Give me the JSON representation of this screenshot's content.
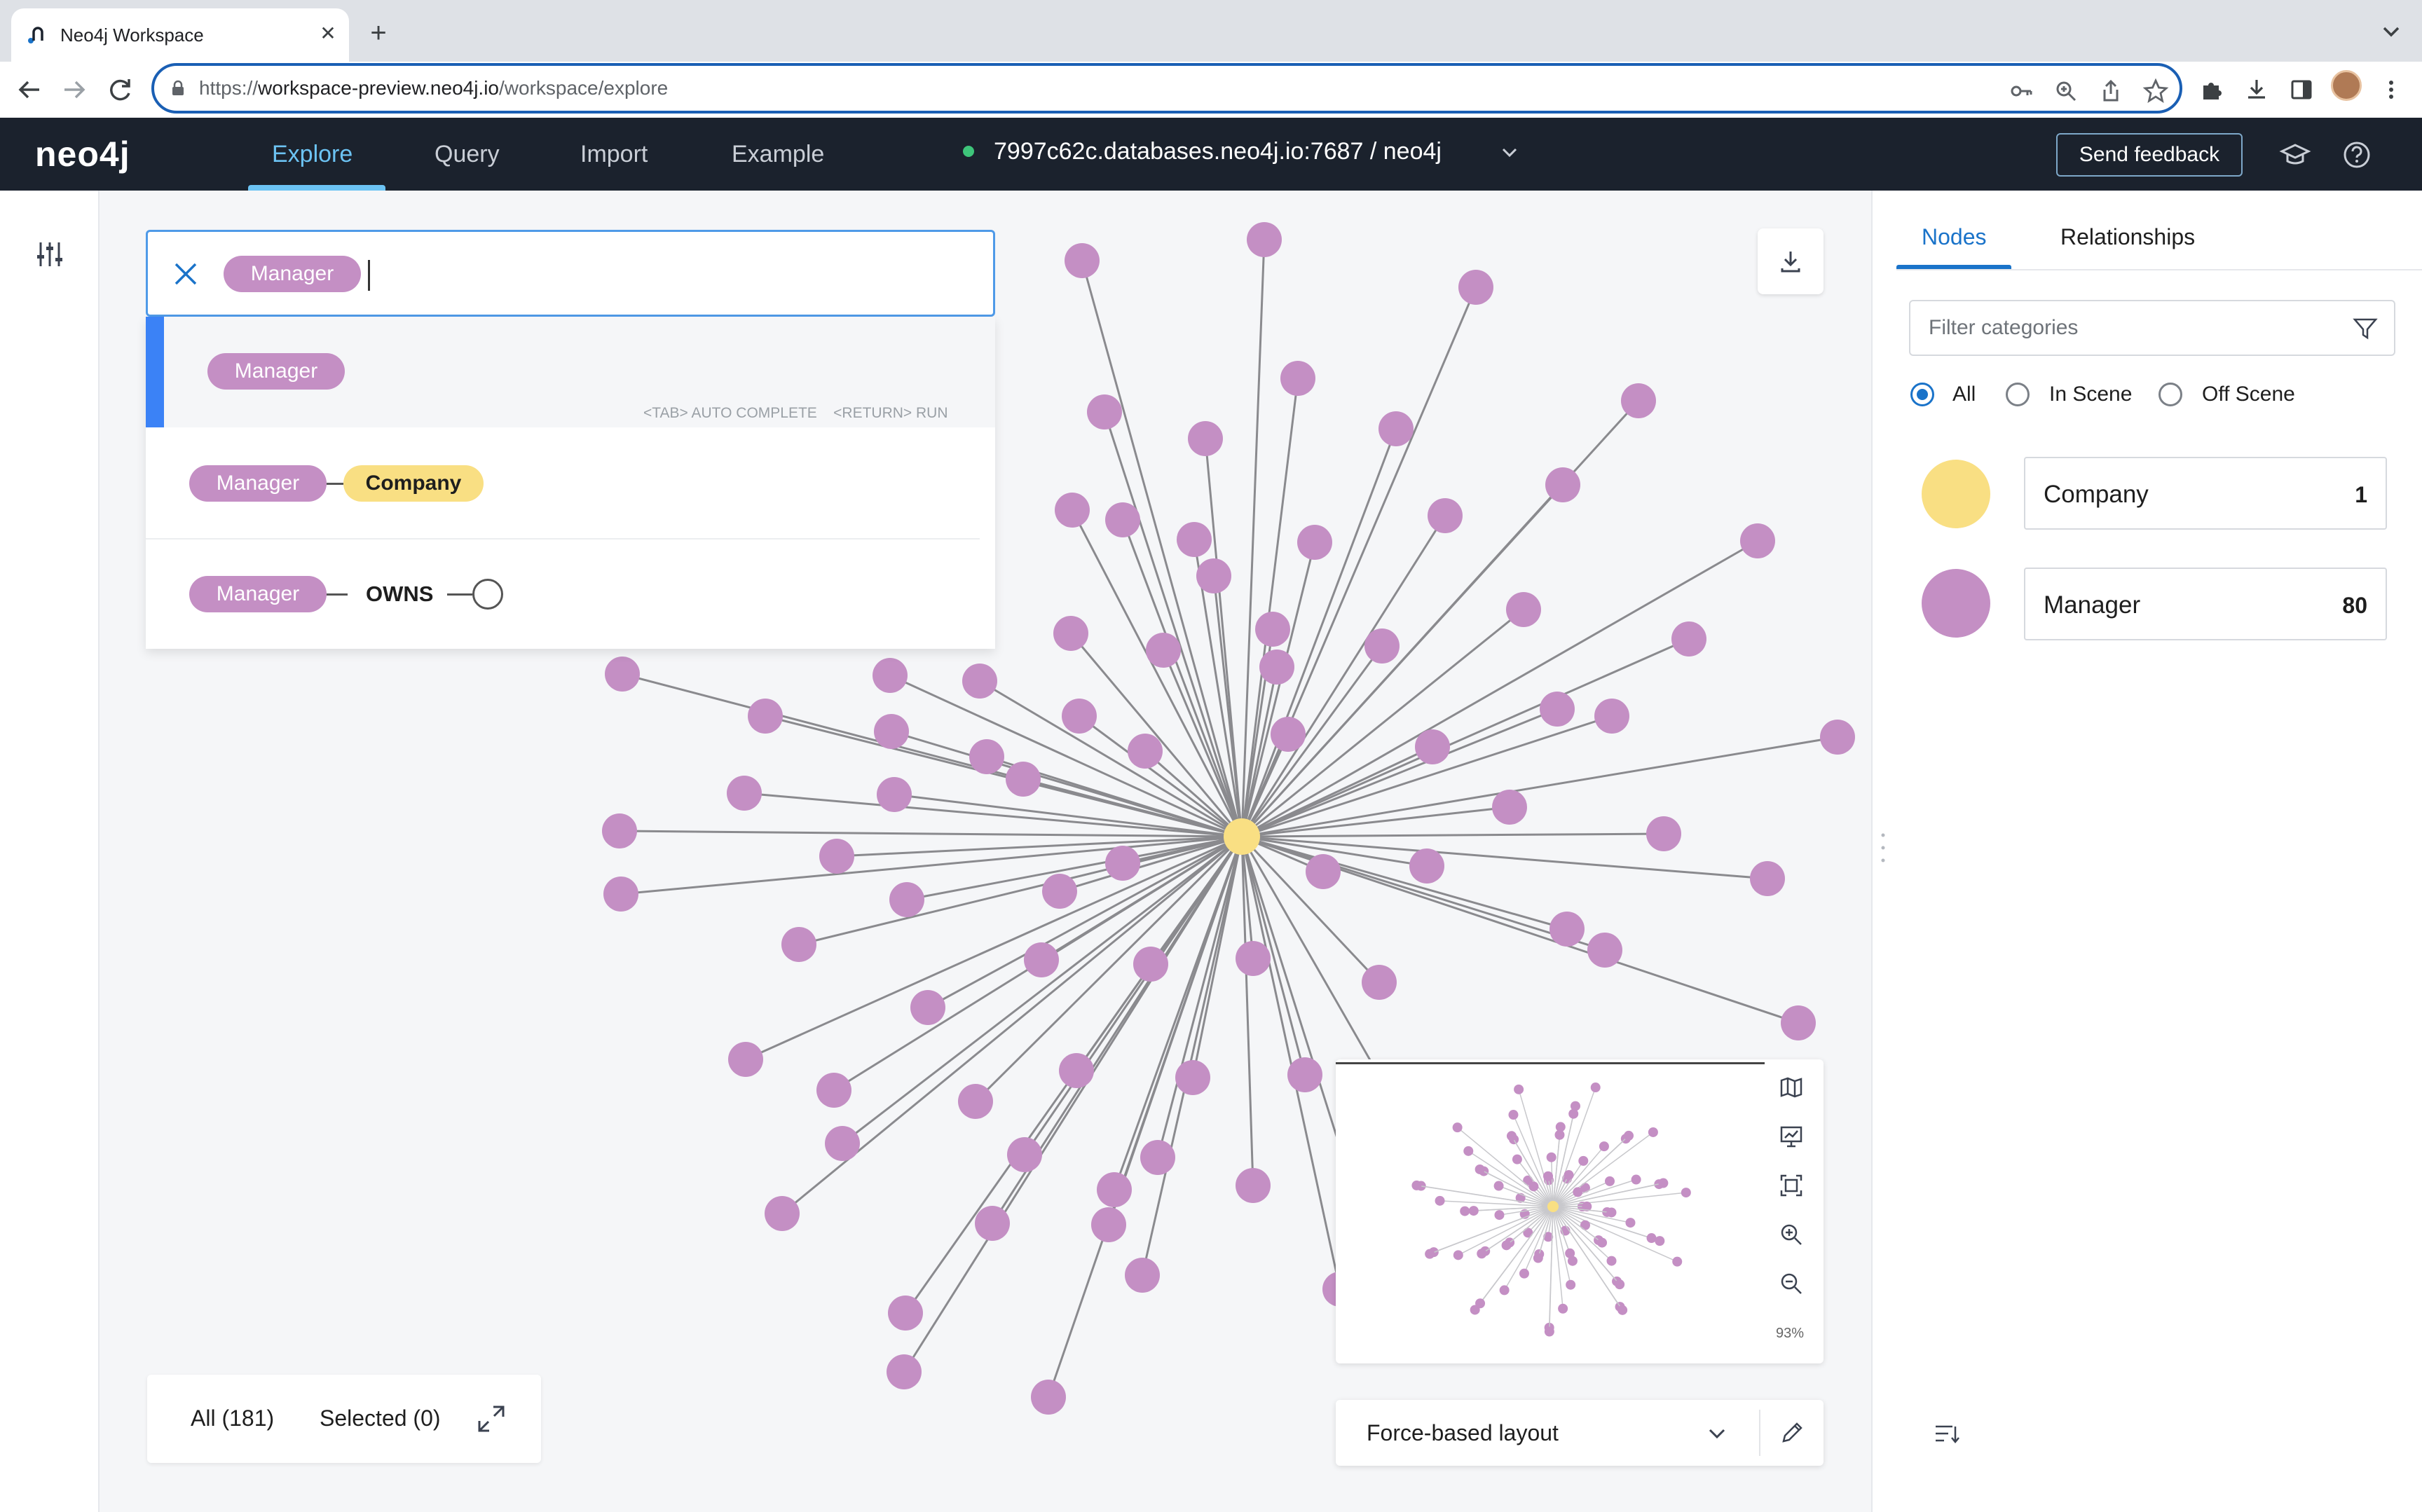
{
  "browser": {
    "tab_title": "Neo4j Workspace",
    "url_prefix": "https://",
    "url_host": "workspace-preview.neo4j.io",
    "url_path": "/workspace/explore"
  },
  "app": {
    "logo": "neo4j",
    "nav": [
      "Explore",
      "Query",
      "Import",
      "Example"
    ],
    "active_nav": "Explore",
    "connection": "7997c62c.databases.neo4j.io:7687 / neo4j",
    "connection_status_color": "#3ec57a",
    "feedback_label": "Send feedback"
  },
  "search": {
    "chip": "Manager",
    "suggestions": {
      "first": {
        "label": "Manager",
        "hint_tab": "<TAB> AUTO COMPLETE",
        "hint_return": "<RETURN> RUN"
      },
      "second": {
        "from": "Manager",
        "to": "Company"
      },
      "third": {
        "from": "Manager",
        "relationship": "OWNS"
      }
    }
  },
  "stats": {
    "all": "All (181)",
    "selected": "Selected (0)"
  },
  "minimap": {
    "zoom": "93%"
  },
  "layout": {
    "selected": "Force-based layout"
  },
  "panel": {
    "tabs": [
      "Nodes",
      "Relationships"
    ],
    "active_tab": "Nodes",
    "filter_placeholder": "Filter categories",
    "scope_options": [
      "All",
      "In Scene",
      "Off Scene"
    ],
    "scope_selected": "All",
    "categories": [
      {
        "name": "Company",
        "count": "1",
        "color": "#f9df83"
      },
      {
        "name": "Manager",
        "count": "80",
        "color": "#c48fc4"
      }
    ]
  },
  "colors": {
    "accent": "#1a73c9",
    "manager": "#c48fc4",
    "company": "#f9df83",
    "header": "#1b222d"
  }
}
